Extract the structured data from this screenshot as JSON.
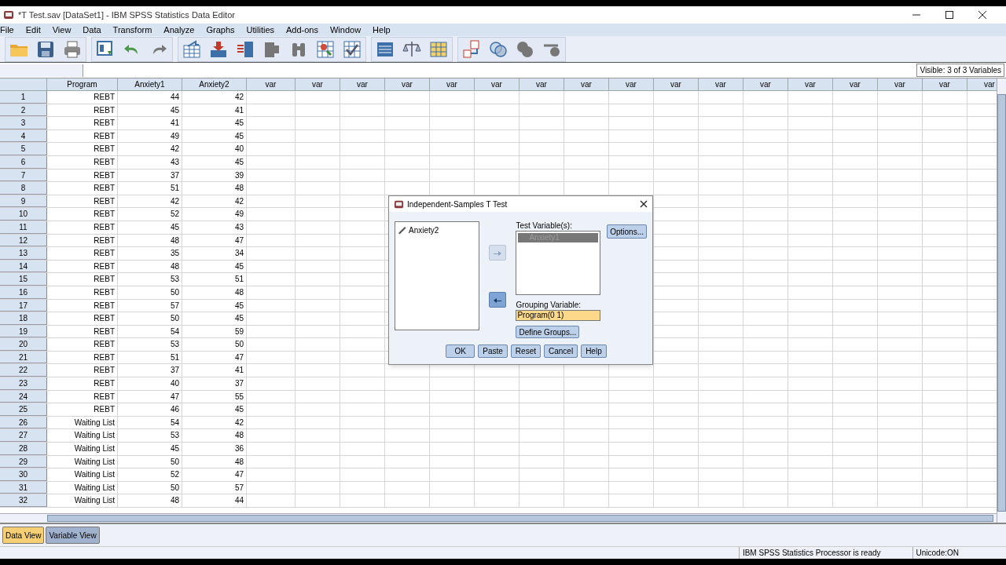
{
  "window": {
    "title": "*T Test.sav [DataSet1] - IBM SPSS Statistics Data Editor"
  },
  "menu": [
    "File",
    "Edit",
    "View",
    "Data",
    "Transform",
    "Analyze",
    "Graphs",
    "Utilities",
    "Add-ons",
    "Window",
    "Help"
  ],
  "visible_info": "Visible: 3 of 3 Variables",
  "table": {
    "columns": [
      "Program",
      "Anxiety1",
      "Anxiety2",
      "var",
      "var",
      "var",
      "var",
      "var",
      "var",
      "var",
      "var",
      "var",
      "var",
      "var",
      "var",
      "var",
      "var",
      "var",
      "var",
      "var"
    ],
    "rows": [
      {
        "num": "1",
        "cells": [
          "REBT",
          "44",
          "42"
        ]
      },
      {
        "num": "2",
        "cells": [
          "REBT",
          "45",
          "41"
        ]
      },
      {
        "num": "3",
        "cells": [
          "REBT",
          "41",
          "45"
        ]
      },
      {
        "num": "4",
        "cells": [
          "REBT",
          "49",
          "45"
        ]
      },
      {
        "num": "5",
        "cells": [
          "REBT",
          "42",
          "40"
        ]
      },
      {
        "num": "6",
        "cells": [
          "REBT",
          "43",
          "45"
        ]
      },
      {
        "num": "7",
        "cells": [
          "REBT",
          "37",
          "39"
        ]
      },
      {
        "num": "8",
        "cells": [
          "REBT",
          "51",
          "48"
        ]
      },
      {
        "num": "9",
        "cells": [
          "REBT",
          "42",
          "42"
        ]
      },
      {
        "num": "10",
        "cells": [
          "REBT",
          "52",
          "49"
        ]
      },
      {
        "num": "11",
        "cells": [
          "REBT",
          "45",
          "43"
        ]
      },
      {
        "num": "12",
        "cells": [
          "REBT",
          "48",
          "47"
        ]
      },
      {
        "num": "13",
        "cells": [
          "REBT",
          "35",
          "34"
        ]
      },
      {
        "num": "14",
        "cells": [
          "REBT",
          "48",
          "45"
        ]
      },
      {
        "num": "15",
        "cells": [
          "REBT",
          "53",
          "51"
        ]
      },
      {
        "num": "16",
        "cells": [
          "REBT",
          "50",
          "48"
        ]
      },
      {
        "num": "17",
        "cells": [
          "REBT",
          "57",
          "45"
        ]
      },
      {
        "num": "18",
        "cells": [
          "REBT",
          "50",
          "45"
        ]
      },
      {
        "num": "19",
        "cells": [
          "REBT",
          "54",
          "59"
        ]
      },
      {
        "num": "20",
        "cells": [
          "REBT",
          "53",
          "50"
        ]
      },
      {
        "num": "21",
        "cells": [
          "REBT",
          "51",
          "47"
        ]
      },
      {
        "num": "22",
        "cells": [
          "REBT",
          "37",
          "41"
        ]
      },
      {
        "num": "23",
        "cells": [
          "REBT",
          "40",
          "37"
        ]
      },
      {
        "num": "24",
        "cells": [
          "REBT",
          "47",
          "55"
        ]
      },
      {
        "num": "25",
        "cells": [
          "REBT",
          "46",
          "45"
        ]
      },
      {
        "num": "26",
        "cells": [
          "Waiting List",
          "54",
          "42"
        ]
      },
      {
        "num": "27",
        "cells": [
          "Waiting List",
          "53",
          "48"
        ]
      },
      {
        "num": "28",
        "cells": [
          "Waiting List",
          "45",
          "36"
        ]
      },
      {
        "num": "29",
        "cells": [
          "Waiting List",
          "50",
          "48"
        ]
      },
      {
        "num": "30",
        "cells": [
          "Waiting List",
          "52",
          "47"
        ]
      },
      {
        "num": "31",
        "cells": [
          "Waiting List",
          "50",
          "57"
        ]
      },
      {
        "num": "32",
        "cells": [
          "Waiting List",
          "48",
          "44"
        ]
      }
    ]
  },
  "dialog": {
    "title": "Independent-Samples T Test",
    "source_items": [
      "Anxiety2"
    ],
    "test_label": "Test Variable(s):",
    "test_items": [
      {
        "label": "Anxiety1",
        "selected": true
      }
    ],
    "move_buttons": [
      {
        "kind": "right",
        "disabled": true
      },
      {
        "kind": "left",
        "disabled": false
      }
    ],
    "grouping_label": "Grouping Variable:",
    "grouping_value": "Program(0 1)",
    "options_button": "Options...",
    "define_button": "Define Groups...",
    "buttons": [
      "OK",
      "Paste",
      "Reset",
      "Cancel",
      "Help"
    ]
  },
  "tabs": [
    {
      "label": "Data View",
      "selected": true
    },
    {
      "label": "Variable View",
      "selected": false
    }
  ],
  "status_bar": [
    "IBM SPSS Statistics Processor is ready",
    "Unicode:ON"
  ]
}
